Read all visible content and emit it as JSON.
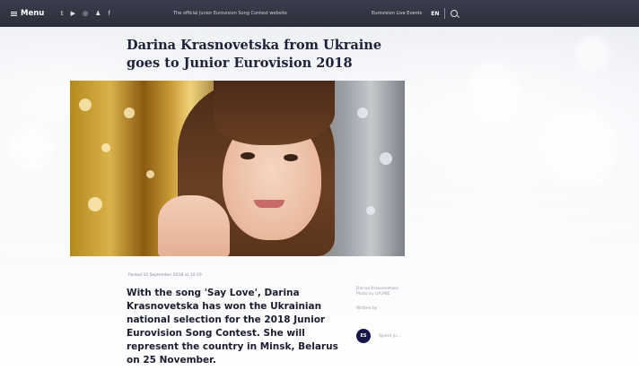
{
  "topbar": {
    "menu_label": "Menu",
    "social_icons": [
      "twitter-icon",
      "youtube-icon",
      "instagram-icon",
      "snapchat-icon",
      "facebook-icon"
    ],
    "social_glyphs": [
      "𝕥",
      "▶",
      "◎",
      "♟",
      "f"
    ],
    "tagline": "The official Junior Eurovision Song Contest website",
    "eurovision_link": "Eurovision Live Events",
    "language": "EN"
  },
  "article": {
    "title": "Darina Krasnovetska from Ukraine goes to Junior Eurovision 2018",
    "posted": "Posted 10 September 2018 at 10:19",
    "lead": "With the song 'Say Love', Darina Krasnovetska has won the Ukrainian national selection for the 2018 Junior Eurovision Song Contest. She will represent the country in Minsk, Belarus on 25 November.",
    "photo_credit": "Darina Krasnovetska\nPhoto by UA:PBC",
    "written_by_label": "Written by",
    "author_initials": "ES",
    "author_name": "Sjoerd Ju..."
  },
  "colors": {
    "topbar": "#2f3340",
    "author_badge": "#16164a"
  }
}
